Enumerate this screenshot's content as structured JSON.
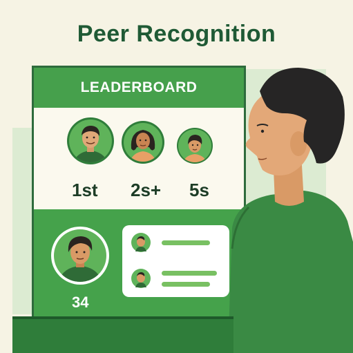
{
  "page": {
    "title": "Peer Recognition"
  },
  "leaderboard": {
    "header": "LEADERBOARD",
    "top_ranks": [
      "1st",
      "2s+",
      "5s"
    ],
    "featured_rank": "34",
    "entries": [
      {
        "progress": 0.7
      },
      {
        "progress": 0.8
      }
    ]
  },
  "colors": {
    "header_green": "#46a04c",
    "dark_green": "#1f5a35",
    "shirt_green": "#3a8a44",
    "background": "#f6f3e4"
  }
}
